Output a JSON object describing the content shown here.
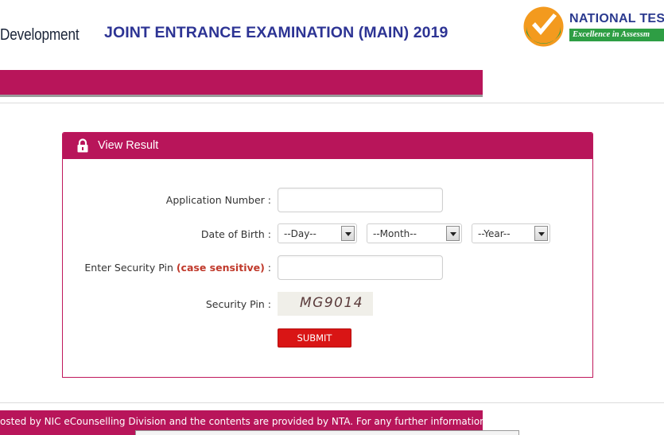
{
  "header": {
    "left_text": "Development",
    "title": "JOINT ENTRANCE EXAMINATION (MAIN) 2019",
    "logo_name": "NATIONAL TES",
    "logo_tagline": "Excellence in Assessm"
  },
  "panel": {
    "title": "View Result",
    "icon": "lock-icon"
  },
  "form": {
    "application_label": "Application Number :",
    "application_value": "",
    "dob_label": "Date of Birth :",
    "day_selected": "--Day--",
    "month_selected": "--Month--",
    "year_selected": "--Year--",
    "pin_label_prefix": "Enter Security Pin ",
    "pin_label_emph": "(case sensitive)",
    "pin_label_suffix": " :",
    "pin_value": "",
    "captcha_label": "Security Pin :",
    "captcha_text": "MG9014",
    "submit_label": "SUBMIT"
  },
  "footer": {
    "text": "osted by NIC eCounselling Division and the contents are provided by NTA. For any further information,"
  },
  "colors": {
    "brand": "#b8155a",
    "title_blue": "#2d3494",
    "submit_red": "#d91515",
    "logo_green": "#2e9e44",
    "logo_orange": "#f39a1e"
  }
}
